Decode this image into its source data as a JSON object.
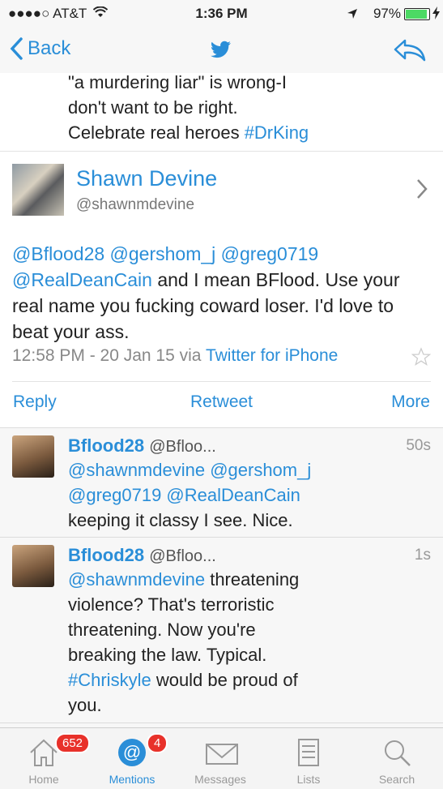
{
  "status": {
    "carrier": "●●●●○ AT&T",
    "time": "1:36 PM",
    "battery": "97%"
  },
  "nav": {
    "back": "Back"
  },
  "previous_tweet": {
    "text": "\"a murdering liar\" is wrong-I\ndon't want to be right.\nCelebrate real heroes ",
    "hashtag": "#DrKing"
  },
  "profile": {
    "name": "Shawn Devine",
    "handle": "@shawnmdevine"
  },
  "tweet": {
    "mentions": "@Bflood28 @gershom_j @greg0719\n@RealDeanCain",
    "text": " and I mean BFlood. Use your real name you fucking coward loser. I'd love to beat your ass.",
    "time": "12:58 PM - 20 Jan 15 via ",
    "source": "Twitter for iPhone"
  },
  "actions": {
    "reply": "Reply",
    "retweet": "Retweet",
    "more": "More"
  },
  "replies": [
    {
      "name": "Bflood28",
      "handle": "@Bfloo...",
      "age": "50s",
      "mentions": "@shawnmdevine @gershom_j\n@greg0719 @RealDeanCain",
      "text": "\nkeeping it classy I see. Nice."
    },
    {
      "name": "Bflood28",
      "handle": "@Bfloo...",
      "age": "1s",
      "mentions": "@shawnmdevine",
      "text": " threatening\nviolence? That's terroristic\nthreatening. Now you're\nbreaking the law. Typical.\n",
      "hashtag": "#Chriskyle",
      "text2": " would be proud of\nyou."
    }
  ],
  "tabs": [
    {
      "label": "Home",
      "badge": "652"
    },
    {
      "label": "Mentions",
      "badge": "4"
    },
    {
      "label": "Messages"
    },
    {
      "label": "Lists"
    },
    {
      "label": "Search"
    }
  ],
  "colors": {
    "accent": "#2a8ed8",
    "badge": "#e8312a",
    "battery": "#4cd964"
  }
}
